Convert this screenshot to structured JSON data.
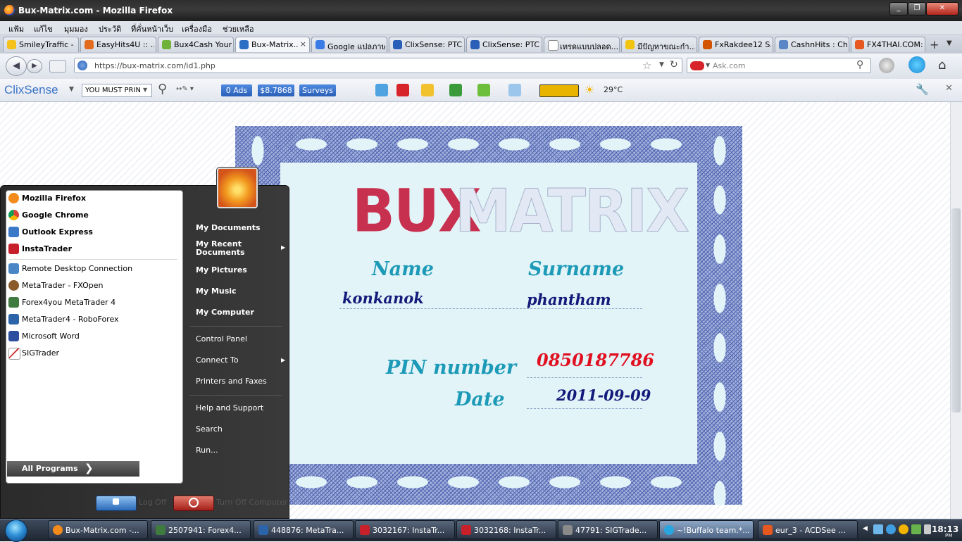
{
  "window": {
    "title": "Bux-Matrix.com - Mozilla Firefox",
    "minimize": "_",
    "restore": "❐",
    "close": "✕"
  },
  "menubar": [
    "แฟ้ม",
    "แก้ไข",
    "มุมมอง",
    "ประวัติ",
    "ที่คั่นหน้าเว็บ",
    "เครื่องมือ",
    "ช่วยเหลือ"
  ],
  "tabs": [
    {
      "label": "SmileyTraffic - ...",
      "color": "#f4c21a"
    },
    {
      "label": "EasyHits4U :: ...",
      "color": "#e26b1f"
    },
    {
      "label": "Bux4Cash Your...",
      "color": "#6fb23a"
    },
    {
      "label": "Bux-Matrix....",
      "color": "#2a6fc4",
      "active": true,
      "close": "×"
    },
    {
      "label": "Google แปลภาษา",
      "color": "#3b7be6"
    },
    {
      "label": "ClixSense: PTC...",
      "color": "#2a5fb8"
    },
    {
      "label": "ClixSense: PTC...",
      "color": "#2a5fb8"
    },
    {
      "label": "เทรดแบบปลอด...",
      "color": "#ffffff"
    },
    {
      "label": "มีปัญหาขณะกำ...",
      "color": "#f1c40f"
    },
    {
      "label": "FxRakdee12 S...",
      "color": "#d35400"
    },
    {
      "label": "CashnHits : Ch...",
      "color": "#5b86c6"
    },
    {
      "label": "FX4THAI.COM:...",
      "color": "#e6581f"
    }
  ],
  "new_tab": "+",
  "nav": {
    "url": "https://bux-matrix.com/id1.php",
    "search_placeholder": "Ask.com",
    "back": "◀",
    "forward": "▶"
  },
  "clixsense": {
    "brand": "ClixSense",
    "ticker_text": "YOU MUST PRIN",
    "ads": "0 Ads",
    "balance": "$8.7868",
    "surveys": "Surveys",
    "weather": "29°C"
  },
  "certificate": {
    "title_part1": "BUX",
    "title_part2": "MATRIX",
    "name_label": "Name",
    "surname_label": "Surname",
    "name_value": "konkanok",
    "surname_value": "phantham",
    "pin_label": "PIN  number",
    "pin_value": "0850187786",
    "date_label": "Date",
    "date_value": "2011-09-09",
    "colors": {
      "bux": "#c8304f",
      "matrix": "#e0e6f2",
      "label": "#1c9ab7",
      "value": "#121a7a",
      "pin": "#e01020"
    }
  },
  "start_menu": {
    "pinned": [
      {
        "label": "Mozilla Firefox",
        "icon": "firefox-icon",
        "color": "#f28a1c"
      },
      {
        "label": "Google Chrome",
        "icon": "chrome-icon",
        "color": "#3e9e3e"
      },
      {
        "label": "Outlook Express",
        "icon": "outlook-icon",
        "color": "#3a78c8"
      },
      {
        "label": "InstaTrader",
        "icon": "instatrader-icon",
        "color": "#c8202a"
      }
    ],
    "recent": [
      {
        "label": "Remote Desktop Connection",
        "icon": "remote-desktop-icon",
        "color": "#4a86c6"
      },
      {
        "label": "MetaTrader - FXOpen",
        "icon": "metatrader-icon",
        "color": "#8a5a2a"
      },
      {
        "label": "Forex4you MetaTrader 4",
        "icon": "metatrader-icon",
        "color": "#3f7a3f"
      },
      {
        "label": "MetaTrader4 - RoboForex",
        "icon": "metatrader-icon",
        "color": "#2b64a8"
      },
      {
        "label": "Microsoft Word",
        "icon": "word-icon",
        "color": "#2b4f9e"
      },
      {
        "label": "SIGTrader",
        "icon": "chart-icon",
        "color": "#8a8a8a"
      }
    ],
    "all_programs": "All Programs",
    "right": [
      {
        "label": "My Documents",
        "bold": true
      },
      {
        "label": "My Recent Documents",
        "bold": true,
        "arrow": true
      },
      {
        "label": "My Pictures",
        "bold": true
      },
      {
        "label": "My Music",
        "bold": true
      },
      {
        "label": "My Computer",
        "bold": true
      },
      {
        "label": "Control Panel"
      },
      {
        "label": "Connect To",
        "arrow": true
      },
      {
        "label": "Printers and Faxes"
      },
      {
        "label": "Help and Support"
      },
      {
        "label": "Search"
      },
      {
        "label": "Run..."
      }
    ],
    "log_off": "Log Off",
    "turn_off": "Turn Off Computer"
  },
  "taskbar": {
    "tasks": [
      {
        "label": "Bux-Matrix.com -...",
        "color": "#f28a1c"
      },
      {
        "label": "2507941: Forex4...",
        "color": "#3f7a3f"
      },
      {
        "label": "448876: MetaTra...",
        "color": "#2b64a8"
      },
      {
        "label": "3032167: InstaTr...",
        "color": "#c8202a"
      },
      {
        "label": "3032168: InstaTr...",
        "color": "#c8202a"
      },
      {
        "label": "47791: SIGTrade...",
        "color": "#8a8a8a"
      },
      {
        "label": "~!Buffalo team.*...",
        "color": "#29a6e0",
        "active": true
      },
      {
        "label": "eur_3 - ACDSee ...",
        "color": "#e6581f"
      }
    ],
    "clock": "18:13",
    "clock_suffix": "PM"
  }
}
